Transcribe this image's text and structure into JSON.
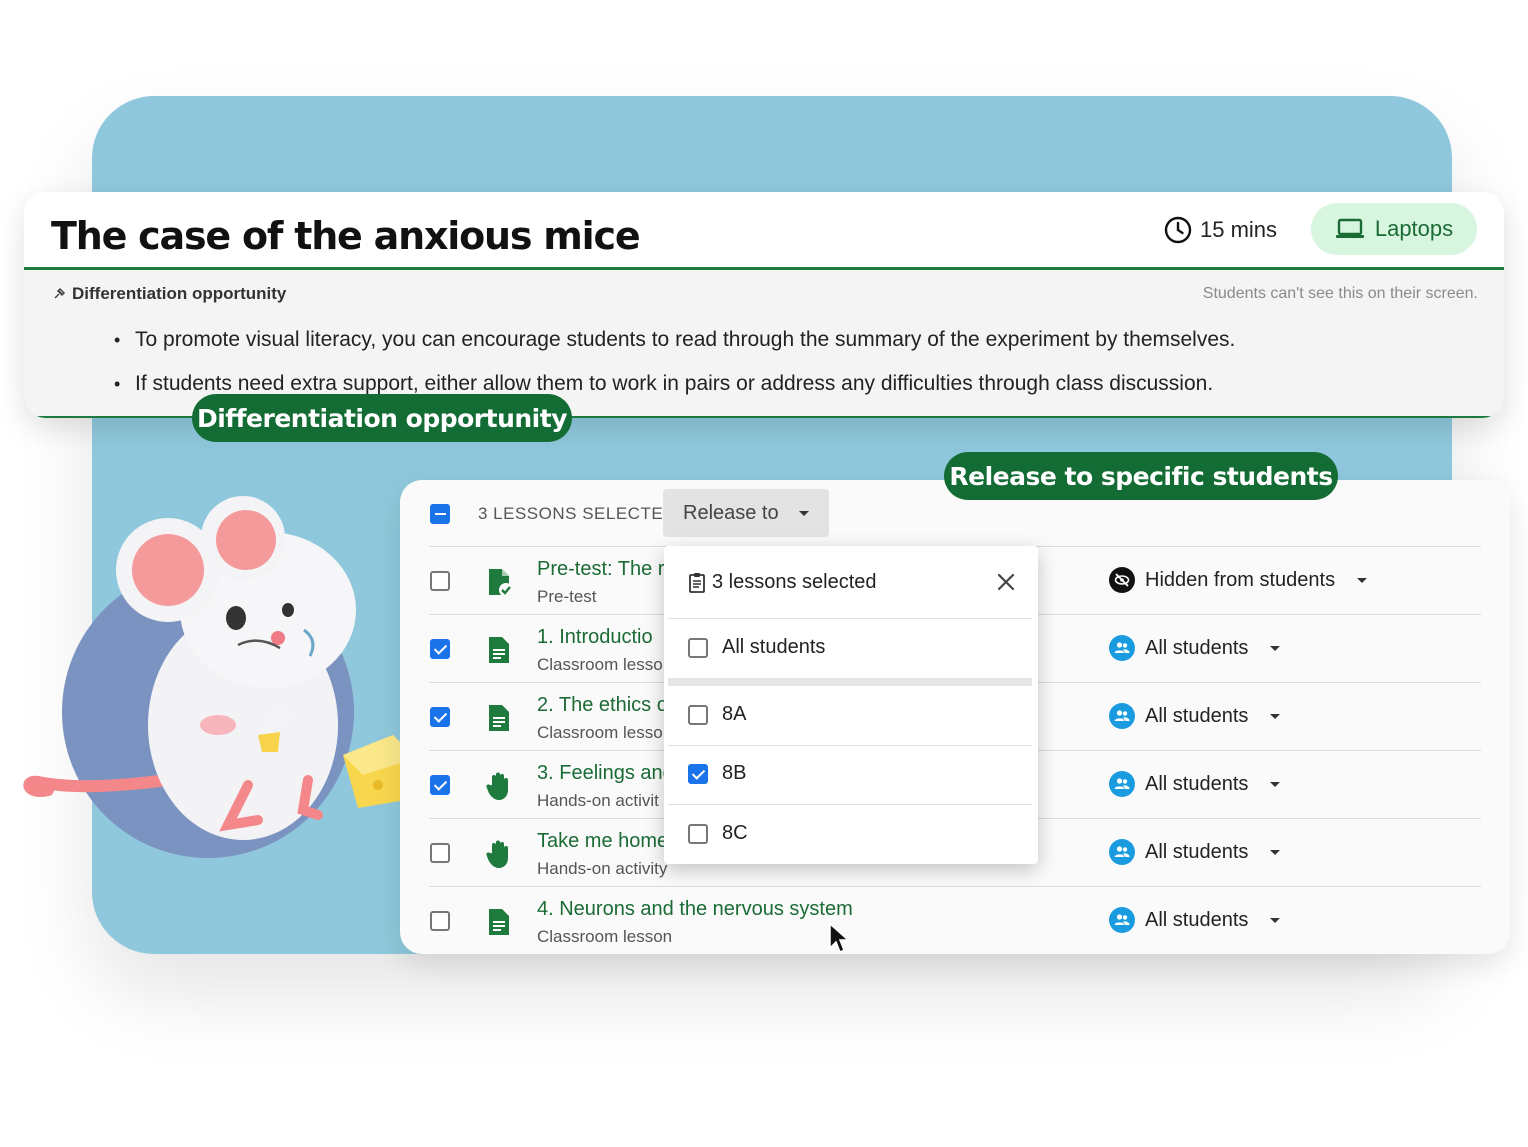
{
  "lesson": {
    "title": "The case of the anxious mice",
    "duration": "15 mins",
    "device": "Laptops"
  },
  "differentiation": {
    "heading": "Differentiation opportunity",
    "note": "Students can't see this on their screen.",
    "bullets": [
      "To promote visual literacy, you can encourage students to read through the summary of the experiment by themselves.",
      "If students need extra support, either allow them to work in pairs or address any difficulties through class discussion."
    ]
  },
  "tags": {
    "differentiation": "Differentiation opportunity",
    "release": "Release to specific students"
  },
  "toolbar": {
    "selected_count": "3 LESSONS SELECTED",
    "release_label": "Release to"
  },
  "rows": [
    {
      "title": "Pre-test: The r",
      "subtitle": "Pre-test",
      "checked": false,
      "icon": "pretest-icon",
      "visibility": "Hidden from students"
    },
    {
      "title": "1. Introductio",
      "subtitle": "Classroom lesso",
      "checked": true,
      "icon": "document-icon",
      "visibility": "All students"
    },
    {
      "title": "2. The ethics o",
      "subtitle": "Classroom lesso",
      "checked": true,
      "icon": "document-icon",
      "visibility": "All students"
    },
    {
      "title": "3. Feelings and",
      "subtitle": "Hands-on activit",
      "checked": true,
      "icon": "hand-icon",
      "visibility": "All students"
    },
    {
      "title": "Take me home",
      "subtitle": "Hands-on activity",
      "checked": false,
      "icon": "hand-icon",
      "visibility": "All students"
    },
    {
      "title": "4. Neurons and the nervous system",
      "subtitle": "Classroom lesson",
      "checked": false,
      "icon": "document-icon",
      "visibility": "All students"
    }
  ],
  "dropdown": {
    "header": "3 lessons selected",
    "options": [
      {
        "label": "All students",
        "checked": false
      },
      {
        "label": "8A",
        "checked": false
      },
      {
        "label": "8B",
        "checked": true
      },
      {
        "label": "8C",
        "checked": false
      }
    ]
  },
  "colors": {
    "brand_green": "#146c35",
    "accent_blue": "#1a73e8",
    "background_blue": "#8fc8dc"
  }
}
